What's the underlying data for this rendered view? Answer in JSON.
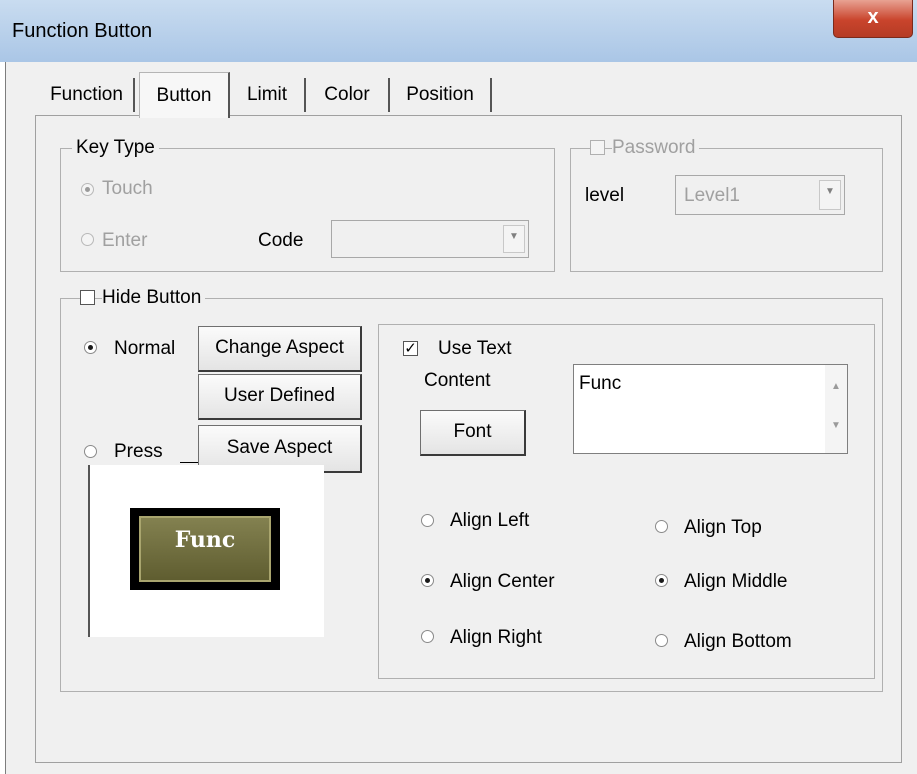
{
  "window": {
    "title": "Function Button",
    "close_glyph": "x"
  },
  "tabs": [
    {
      "label": "Function",
      "active": false
    },
    {
      "label": "Button",
      "active": true
    },
    {
      "label": "Limit",
      "active": false
    },
    {
      "label": "Color",
      "active": false
    },
    {
      "label": "Position",
      "active": false
    }
  ],
  "key_type": {
    "title": "Key Type",
    "touch_label": "Touch",
    "enter_label": "Enter",
    "selected": "Touch",
    "code_label": "Code",
    "code_value": ""
  },
  "password": {
    "checkbox_label": "Password",
    "checked": false,
    "level_label": "level",
    "level_value": "Level1"
  },
  "hide_button": {
    "checkbox_label": "Hide Button",
    "checked": false,
    "normal_label": "Normal",
    "press_label": "Press",
    "selected": "Normal",
    "change_aspect_label": "Change Aspect",
    "user_defined_label": "User Defined",
    "save_aspect_label": "Save Aspect",
    "preview_text": "Func"
  },
  "text_options": {
    "use_text_label": "Use Text",
    "use_text_checked": true,
    "content_label": "Content",
    "content_value": "Func",
    "font_button_label": "Font",
    "align_left_label": "Align Left",
    "align_center_label": "Align Center",
    "align_right_label": "Align Right",
    "align_top_label": "Align Top",
    "align_middle_label": "Align Middle",
    "align_bottom_label": "Align Bottom",
    "horizontal_selected": "Align Center",
    "vertical_selected": "Align Middle"
  },
  "colors": {
    "titlebar": "#aac6e6",
    "close_button": "#c9442c",
    "preview_button": "#6f6d3e"
  }
}
